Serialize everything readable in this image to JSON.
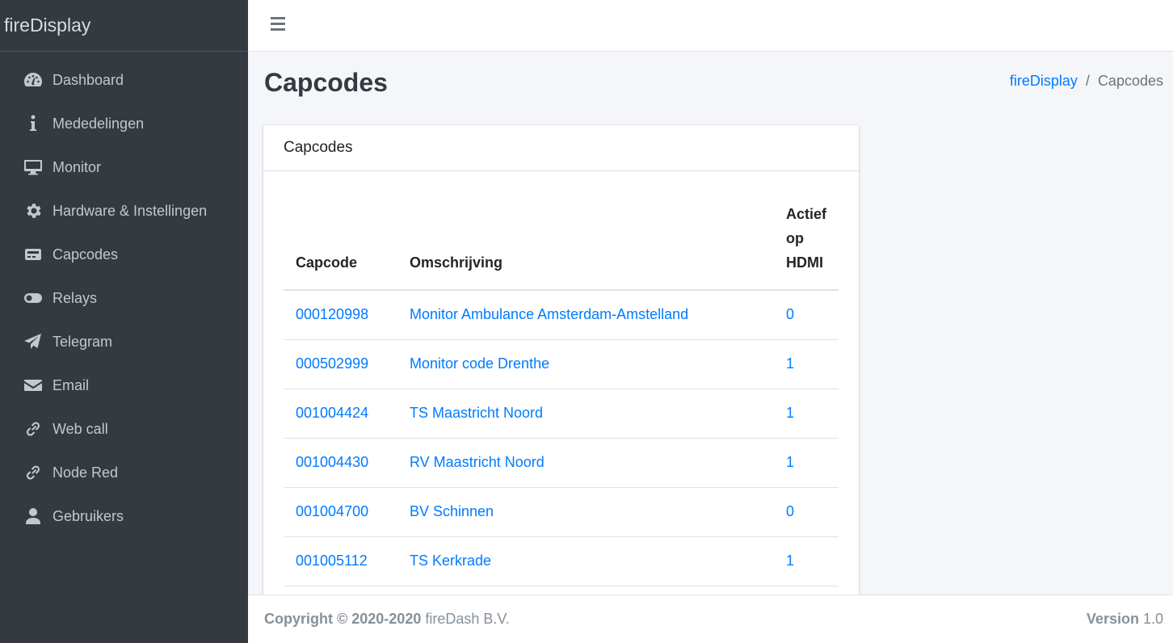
{
  "brand": {
    "title": "fireDisplay"
  },
  "sidebar": {
    "items": [
      {
        "label": "Dashboard",
        "icon": "tachometer-icon"
      },
      {
        "label": "Mededelingen",
        "icon": "info-icon"
      },
      {
        "label": "Monitor",
        "icon": "desktop-icon"
      },
      {
        "label": "Hardware & Instellingen",
        "icon": "gear-icon"
      },
      {
        "label": "Capcodes",
        "icon": "pager-icon"
      },
      {
        "label": "Relays",
        "icon": "toggle-icon"
      },
      {
        "label": "Telegram",
        "icon": "paper-plane-icon"
      },
      {
        "label": "Email",
        "icon": "envelope-icon"
      },
      {
        "label": "Web call",
        "icon": "link-icon"
      },
      {
        "label": "Node Red",
        "icon": "link-icon"
      },
      {
        "label": "Gebruikers",
        "icon": "user-icon"
      }
    ]
  },
  "header": {
    "menu_icon": "hamburger-icon"
  },
  "page": {
    "title": "Capcodes",
    "breadcrumb": {
      "home": "fireDisplay",
      "separator": "/",
      "current": "Capcodes"
    }
  },
  "card": {
    "title": "Capcodes",
    "table": {
      "headers": {
        "capcode": "Capcode",
        "description": "Omschrijving",
        "hdmi": "Actief op HDMI"
      },
      "rows": [
        {
          "capcode": "000120998",
          "description": "Monitor Ambulance Amsterdam-Amstelland",
          "hdmi": "0"
        },
        {
          "capcode": "000502999",
          "description": "Monitor code Drenthe",
          "hdmi": "1"
        },
        {
          "capcode": "001004424",
          "description": "TS Maastricht Noord",
          "hdmi": "1"
        },
        {
          "capcode": "001004430",
          "description": "RV Maastricht Noord",
          "hdmi": "1"
        },
        {
          "capcode": "001004700",
          "description": "BV Schinnen",
          "hdmi": "0"
        },
        {
          "capcode": "001005112",
          "description": "TS Kerkrade",
          "hdmi": "1"
        }
      ]
    }
  },
  "footer": {
    "copyright_label": "Copyright © 2020-2020",
    "company": "fireDash B.V.",
    "version_label": "Version",
    "version": "1.0"
  },
  "colors": {
    "sidebar_bg": "#343a40",
    "link": "#007bff",
    "content_bg": "#f4f6f9"
  }
}
